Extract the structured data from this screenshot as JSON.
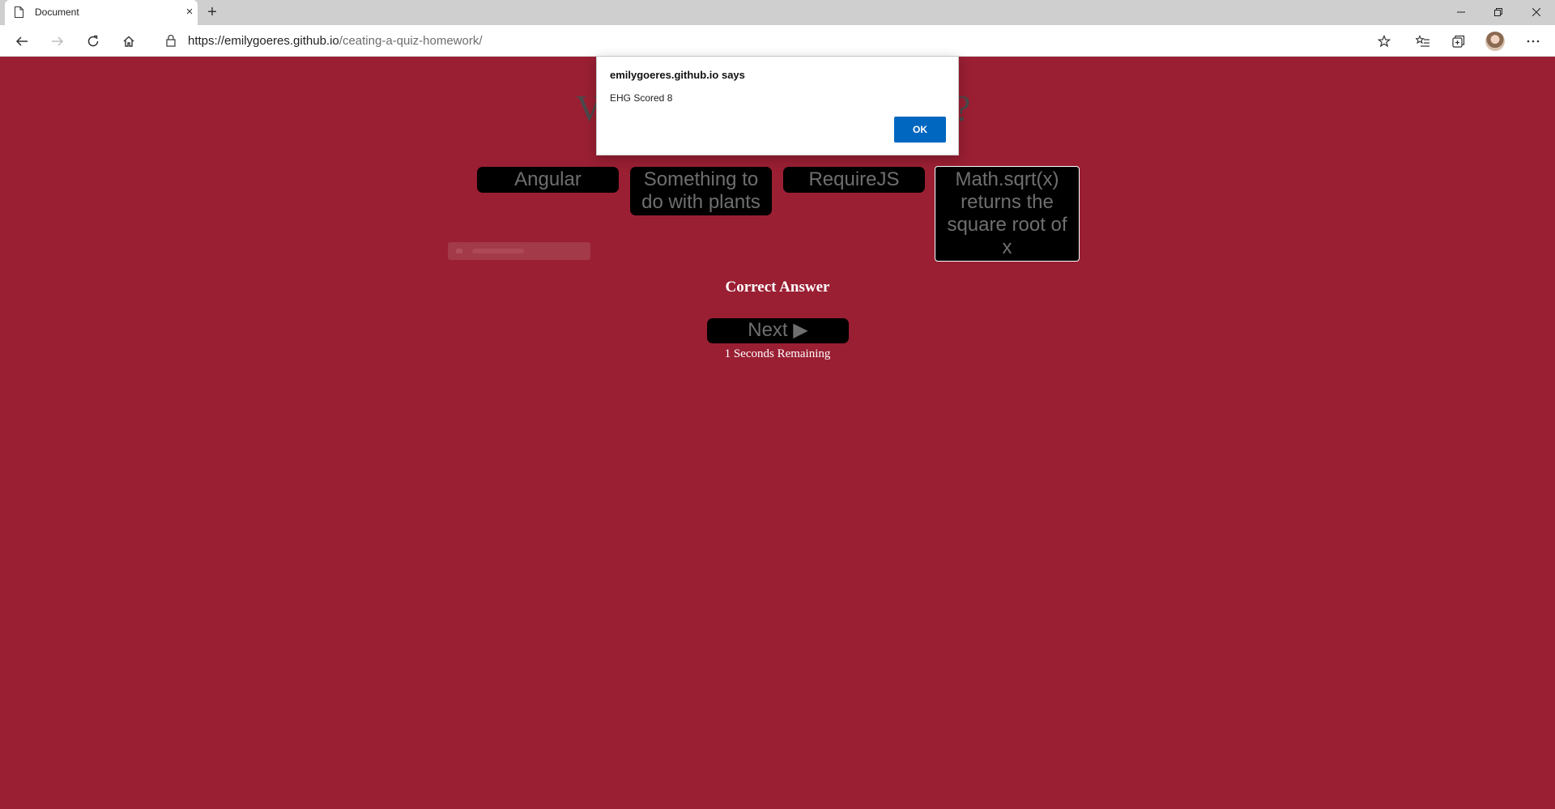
{
  "browser": {
    "tab_title": "Document",
    "tab_close": "×",
    "new_tab": "+",
    "url_host": "https://emilygoeres.github.io",
    "url_path": "/ceating-a-quiz-homework/"
  },
  "quiz": {
    "question_left": "V",
    "question_right": "?",
    "answers": [
      "Angular",
      "Something to do with plants",
      "RequireJS",
      "Math.sqrt(x) returns the square root of x"
    ],
    "result": "Correct Answer",
    "next_label": "Next ▶",
    "timer": "1 Seconds Remaining"
  },
  "dialog": {
    "title": "emilygoeres.github.io says",
    "message": "EHG Scored 8",
    "ok_label": "OK"
  },
  "colors": {
    "page_background": "#9a1f33",
    "button_background": "#000000",
    "dialog_ok": "#0067c0"
  },
  "icons": [
    "document-icon",
    "back-icon",
    "forward-icon",
    "refresh-icon",
    "home-icon",
    "lock-icon",
    "star-icon",
    "favorites-icon",
    "collections-icon",
    "profile-avatar",
    "more-icon",
    "minimize-icon",
    "restore-icon",
    "close-window-icon"
  ]
}
